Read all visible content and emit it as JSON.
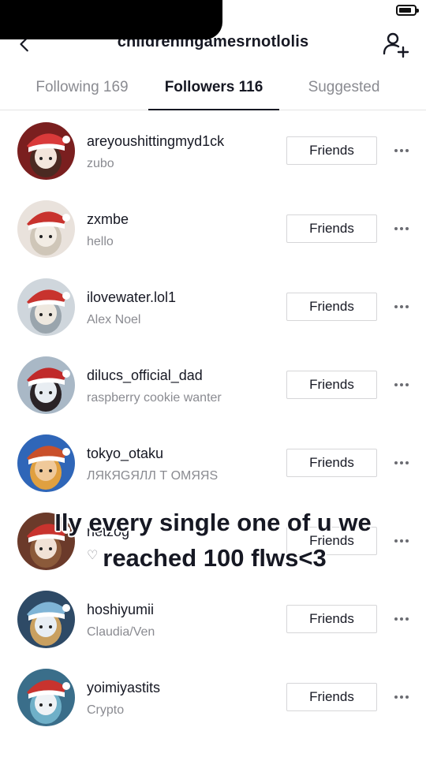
{
  "header": {
    "title": "childreningamesrnotlolis"
  },
  "tabs": [
    {
      "label": "Following 169",
      "active": false
    },
    {
      "label": "Followers 116",
      "active": true
    },
    {
      "label": "Suggested",
      "active": false
    }
  ],
  "followers": [
    {
      "username": "areyoushittingmyd1ck",
      "nickname": "zubo",
      "button": "Friends",
      "avatar_colors": [
        "#7a1f1f",
        "#d93a3a",
        "#f3e6dc",
        "#4b2a22"
      ]
    },
    {
      "username": "zxmbe",
      "nickname": "hello",
      "button": "Friends",
      "avatar_colors": [
        "#e9e2dc",
        "#c8332e",
        "#f2ece4",
        "#cfc6b8"
      ]
    },
    {
      "username": "ilovewater.lol1",
      "nickname": "Alex Noel",
      "button": "Friends",
      "avatar_colors": [
        "#cfd6dc",
        "#c8332e",
        "#eee8df",
        "#9aa5ad"
      ]
    },
    {
      "username": "dilucs_official_dad",
      "nickname": "raspberry cookie wanter",
      "button": "Friends",
      "avatar_colors": [
        "#a9b8c6",
        "#c02a2a",
        "#e8edf2",
        "#2a2326"
      ]
    },
    {
      "username": "tokyo_otaku",
      "nickname": "ЛЯКЯGЯЛЛ Т ОМЯЯS",
      "button": "Friends",
      "avatar_colors": [
        "#2f66b8",
        "#c9502b",
        "#f0c99a",
        "#e0a040"
      ]
    },
    {
      "username": "netzog",
      "nickname": "♡",
      "button": "Friends",
      "avatar_colors": [
        "#6b3a2a",
        "#c8332e",
        "#f1e2d6",
        "#8b5a3a"
      ]
    },
    {
      "username": "hoshiyumii",
      "nickname": "Claudia/Ven",
      "button": "Friends",
      "avatar_colors": [
        "#2e4a66",
        "#7fb4d6",
        "#e8eef4",
        "#c9a060"
      ]
    },
    {
      "username": "yoimiyastits",
      "nickname": "Crypto",
      "button": "Friends",
      "avatar_colors": [
        "#3a6e8a",
        "#c8332e",
        "#eef2f5",
        "#6fb0c8"
      ]
    }
  ],
  "caption": {
    "line1": "Ily every single one of u we",
    "line2": "reached 100 flws<3"
  }
}
